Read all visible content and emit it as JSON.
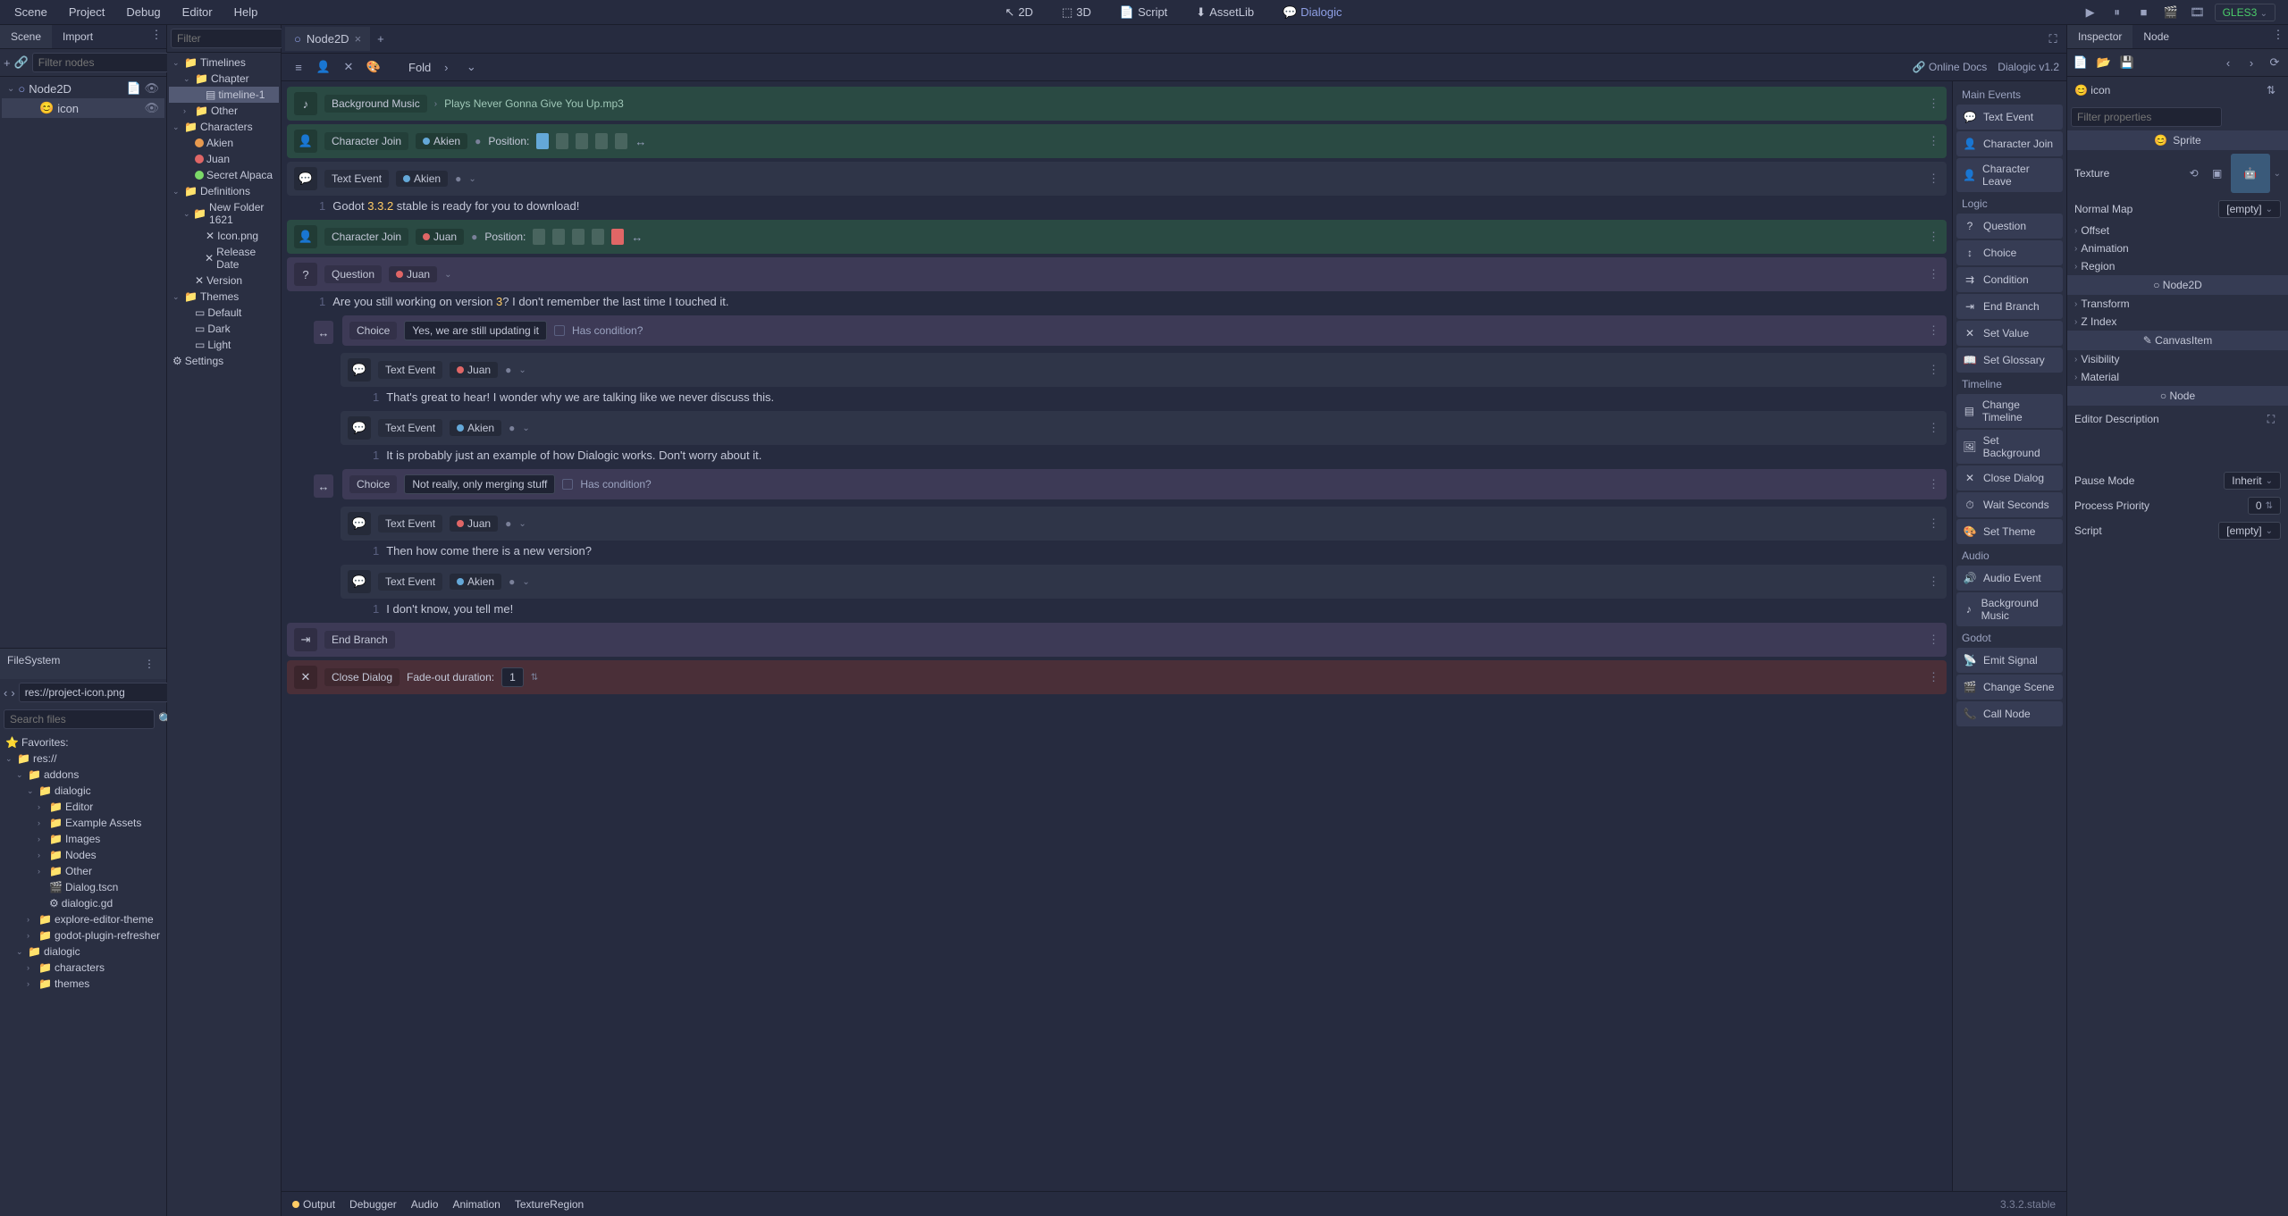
{
  "menubar": {
    "items": [
      "Scene",
      "Project",
      "Debug",
      "Editor",
      "Help"
    ],
    "modes": [
      "2D",
      "3D",
      "Script",
      "AssetLib",
      "Dialogic"
    ],
    "renderer": "GLES3"
  },
  "scene_panel": {
    "tabs": [
      "Scene",
      "Import"
    ],
    "filter_placeholder": "Filter nodes",
    "nodes": [
      {
        "name": "Node2D",
        "icon": "node2d"
      },
      {
        "name": "icon",
        "icon": "sprite",
        "selected": true
      }
    ]
  },
  "resource_tree": {
    "filter_placeholder": "Filter",
    "items": [
      {
        "name": "Timelines",
        "type": "folder",
        "depth": 0,
        "expanded": true
      },
      {
        "name": "Chapter",
        "type": "folder",
        "depth": 1,
        "expanded": true
      },
      {
        "name": "timeline-1",
        "type": "timeline",
        "depth": 2,
        "selected": true
      },
      {
        "name": "Other",
        "type": "folder",
        "depth": 1,
        "collapsed": true
      },
      {
        "name": "Characters",
        "type": "folder",
        "depth": 0,
        "expanded": true
      },
      {
        "name": "Akien",
        "type": "character",
        "depth": 1,
        "color": "#e89a4f"
      },
      {
        "name": "Juan",
        "type": "character",
        "depth": 1,
        "color": "#e06666"
      },
      {
        "name": "Secret Alpaca",
        "type": "character",
        "depth": 1,
        "color": "#7bd968"
      },
      {
        "name": "Definitions",
        "type": "folder",
        "depth": 0,
        "expanded": true
      },
      {
        "name": "New Folder 1621",
        "type": "folder",
        "depth": 1,
        "expanded": true
      },
      {
        "name": "Icon.png",
        "type": "def",
        "depth": 2
      },
      {
        "name": "Release Date",
        "type": "def",
        "depth": 2
      },
      {
        "name": "Version",
        "type": "def",
        "depth": 1
      },
      {
        "name": "Themes",
        "type": "folder",
        "depth": 0,
        "expanded": true
      },
      {
        "name": "Default",
        "type": "theme",
        "depth": 1
      },
      {
        "name": "Dark",
        "type": "theme",
        "depth": 1
      },
      {
        "name": "Light",
        "type": "theme",
        "depth": 1
      },
      {
        "name": "Settings",
        "type": "settings",
        "depth": 0
      }
    ]
  },
  "filesystem": {
    "title": "FileSystem",
    "path": "res://project-icon.png",
    "search_placeholder": "Search files",
    "favorites": "Favorites:",
    "tree": [
      {
        "name": "res://",
        "depth": 0,
        "expanded": true,
        "folder": true
      },
      {
        "name": "addons",
        "depth": 1,
        "expanded": true,
        "folder": true
      },
      {
        "name": "dialogic",
        "depth": 2,
        "expanded": true,
        "folder": true
      },
      {
        "name": "Editor",
        "depth": 3,
        "folder": true
      },
      {
        "name": "Example Assets",
        "depth": 3,
        "folder": true
      },
      {
        "name": "Images",
        "depth": 3,
        "folder": true
      },
      {
        "name": "Nodes",
        "depth": 3,
        "folder": true
      },
      {
        "name": "Other",
        "depth": 3,
        "folder": true
      },
      {
        "name": "Dialog.tscn",
        "depth": 3,
        "folder": false,
        "icon": "scene"
      },
      {
        "name": "dialogic.gd",
        "depth": 3,
        "folder": false,
        "icon": "gear"
      },
      {
        "name": "explore-editor-theme",
        "depth": 2,
        "folder": true
      },
      {
        "name": "godot-plugin-refresher",
        "depth": 2,
        "folder": true
      },
      {
        "name": "dialogic",
        "depth": 1,
        "expanded": true,
        "folder": true
      },
      {
        "name": "characters",
        "depth": 2,
        "folder": true
      },
      {
        "name": "themes",
        "depth": 2,
        "folder": true
      }
    ]
  },
  "editor": {
    "tab_name": "Node2D",
    "fold_label": "Fold",
    "online_docs": "Online Docs",
    "version_label": "Dialogic v1.2",
    "events": [
      {
        "type": "bg_music",
        "label": "Background Music",
        "detail": "Plays Never Gonna Give You Up.mp3",
        "class": "green"
      },
      {
        "type": "char_join",
        "label": "Character Join",
        "char": "Akien",
        "char_color": "#64a8d8",
        "pos": 0,
        "pos_label": "Position:",
        "class": "green"
      },
      {
        "type": "text",
        "label": "Text Event",
        "char": "Akien",
        "char_color": "#64a8d8",
        "line": "Godot <hl>3.3.2</hl> stable is ready for you to download!"
      },
      {
        "type": "char_join",
        "label": "Character Join",
        "char": "Juan",
        "char_color": "#e06666",
        "pos": 4,
        "pos_label": "Position:",
        "class": "green",
        "red_slots": true
      },
      {
        "type": "question",
        "label": "Question",
        "char": "Juan",
        "char_color": "#e06666",
        "class": "purple",
        "line": "Are you still working on version <hl>3</hl>? I don't remember the last time I touched it."
      },
      {
        "type": "choice",
        "label": "Choice",
        "text": "Yes, we are still updating it",
        "cond": "Has condition?",
        "class": "purple",
        "indent": 1
      },
      {
        "type": "text",
        "label": "Text Event",
        "char": "Juan",
        "char_color": "#e06666",
        "line": "That's great to hear! I wonder why we are talking like we never discuss this.",
        "indent": 2
      },
      {
        "type": "text",
        "label": "Text Event",
        "char": "Akien",
        "char_color": "#64a8d8",
        "line": "It is probably just an example of how Dialogic works. Don't worry about it.",
        "indent": 2
      },
      {
        "type": "choice",
        "label": "Choice",
        "text": "Not really, only merging stuff",
        "cond": "Has condition?",
        "class": "purple",
        "indent": 1
      },
      {
        "type": "text",
        "label": "Text Event",
        "char": "Juan",
        "char_color": "#e06666",
        "line": "Then how come there is a new version?",
        "indent": 2
      },
      {
        "type": "text",
        "label": "Text Event",
        "char": "Akien",
        "char_color": "#64a8d8",
        "line": "I don't know, you tell me!",
        "indent": 2
      },
      {
        "type": "end_branch",
        "label": "End Branch",
        "class": "purple"
      },
      {
        "type": "close",
        "label": "Close Dialog",
        "fade_label": "Fade-out duration:",
        "fade": "1",
        "class": "red"
      }
    ]
  },
  "event_sidebar": {
    "categories": [
      {
        "name": "Main Events",
        "items": [
          "Text Event",
          "Character Join",
          "Character Leave"
        ]
      },
      {
        "name": "Logic",
        "items": [
          "Question",
          "Choice",
          "Condition",
          "End Branch",
          "Set Value",
          "Set Glossary"
        ]
      },
      {
        "name": "Timeline",
        "items": [
          "Change Timeline",
          "Set Background",
          "Close Dialog",
          "Wait Seconds",
          "Set Theme"
        ]
      },
      {
        "name": "Audio",
        "items": [
          "Audio Event",
          "Background Music"
        ]
      },
      {
        "name": "Godot",
        "items": [
          "Emit Signal",
          "Change Scene",
          "Call Node"
        ]
      }
    ]
  },
  "inspector": {
    "tabs": [
      "Inspector",
      "Node"
    ],
    "node_name": "icon",
    "filter_placeholder": "Filter properties",
    "sprite_label": "Sprite",
    "texture_label": "Texture",
    "normal_map_label": "Normal Map",
    "normal_map_value": "[empty]",
    "groups": [
      "Offset",
      "Animation",
      "Region"
    ],
    "node2d_header": "Node2D",
    "node2d_groups": [
      "Transform",
      "Z Index"
    ],
    "canvas_header": "CanvasItem",
    "canvas_groups": [
      "Visibility",
      "Material"
    ],
    "node_header": "Node",
    "editor_desc_label": "Editor Description",
    "pause_mode_label": "Pause Mode",
    "pause_mode_value": "Inherit",
    "process_priority_label": "Process Priority",
    "process_priority_value": "0",
    "script_label": "Script",
    "script_value": "[empty]"
  },
  "bottom": {
    "tabs": [
      "Output",
      "Debugger",
      "Audio",
      "Animation",
      "TextureRegion"
    ],
    "version": "3.3.2.stable"
  }
}
